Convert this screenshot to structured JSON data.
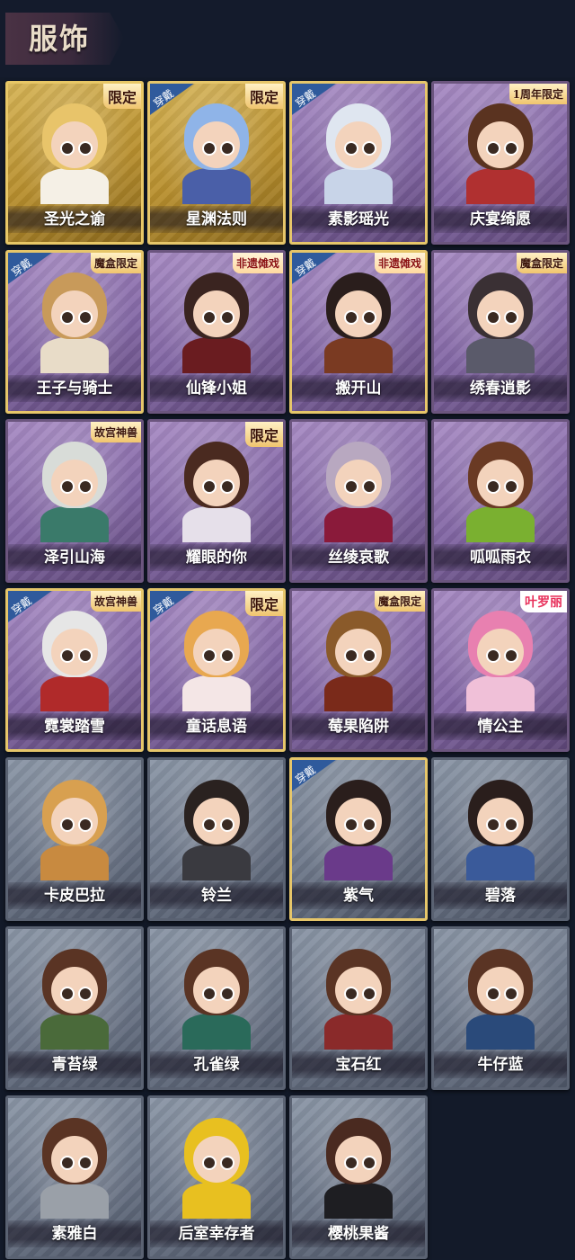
{
  "title": "服饰",
  "worn_label": "穿戴",
  "colors": {
    "gold": "#d6b456",
    "purple": "#8468a6",
    "grey": "#6d7789",
    "worn_badge": "#2f5a9c"
  },
  "costumes": [
    {
      "name": "圣光之谕",
      "rarity": "gold",
      "worn": false,
      "tag": "限定",
      "hair": "#e8c46a",
      "outfit": "#f5f0e6"
    },
    {
      "name": "星渊法则",
      "rarity": "gold",
      "worn": true,
      "tag": "限定",
      "hair": "#8fb4e8",
      "outfit": "#4a5fa8"
    },
    {
      "name": "素影瑶光",
      "rarity": "purple",
      "worn": true,
      "tag": "",
      "hair": "#dfe6f0",
      "outfit": "#c8d4e8"
    },
    {
      "name": "庆宴绮愿",
      "rarity": "purple",
      "worn": false,
      "tag": "1周年限定",
      "hair": "#5a3320",
      "outfit": "#b03030"
    },
    {
      "name": "王子与骑士",
      "rarity": "purple",
      "worn": true,
      "tag": "魔盒限定",
      "hair": "#c89a5a",
      "outfit": "#e8dcc8"
    },
    {
      "name": "仙锋小姐",
      "rarity": "purple",
      "worn": false,
      "tag": "非遗傩戏",
      "hair": "#3a2420",
      "outfit": "#6a1c20"
    },
    {
      "name": "搬开山",
      "rarity": "purple",
      "worn": true,
      "tag": "非遗傩戏",
      "hair": "#2a1e1c",
      "outfit": "#7a3a22"
    },
    {
      "name": "绣春逍影",
      "rarity": "purple",
      "worn": false,
      "tag": "魔盒限定",
      "hair": "#3a3034",
      "outfit": "#5a5a6a"
    },
    {
      "name": "泽引山海",
      "rarity": "purple",
      "worn": false,
      "tag": "故宫神兽",
      "hair": "#d8dcd8",
      "outfit": "#3a7a6a"
    },
    {
      "name": "耀眼的你",
      "rarity": "purple",
      "worn": false,
      "tag": "限定",
      "hair": "#4a2a20",
      "outfit": "#e6e0ea"
    },
    {
      "name": "丝绫哀歌",
      "rarity": "purple",
      "worn": false,
      "tag": "",
      "hair": "#b8a8c0",
      "outfit": "#8a1a3a"
    },
    {
      "name": "呱呱雨衣",
      "rarity": "purple",
      "worn": false,
      "tag": "",
      "hair": "#6a3a24",
      "outfit": "#7ab030"
    },
    {
      "name": "霓裳踏雪",
      "rarity": "purple",
      "worn": true,
      "tag": "故宫神兽",
      "hair": "#e6e6e6",
      "outfit": "#b02a2a"
    },
    {
      "name": "童话息语",
      "rarity": "purple",
      "worn": true,
      "tag": "限定",
      "hair": "#e8a850",
      "outfit": "#f4e6e6"
    },
    {
      "name": "莓果陷阱",
      "rarity": "purple",
      "worn": false,
      "tag": "魔盒限定",
      "hair": "#8a5a2a",
      "outfit": "#7a2a1a"
    },
    {
      "name": "情公主",
      "rarity": "purple",
      "worn": false,
      "tag": "叶罗丽",
      "hair": "#e880b0",
      "outfit": "#f0c0d8"
    },
    {
      "name": "卡皮巴拉",
      "rarity": "grey",
      "worn": false,
      "tag": "",
      "hair": "#d8a050",
      "outfit": "#c88a40"
    },
    {
      "name": "铃兰",
      "rarity": "grey",
      "worn": false,
      "tag": "",
      "hair": "#2a2220",
      "outfit": "#3a3a40"
    },
    {
      "name": "紫气",
      "rarity": "grey",
      "worn": true,
      "tag": "",
      "hair": "#2a1e1c",
      "outfit": "#6a3a8a"
    },
    {
      "name": "碧落",
      "rarity": "grey",
      "worn": false,
      "tag": "",
      "hair": "#2a1e1c",
      "outfit": "#3a5a9a"
    },
    {
      "name": "青苔绿",
      "rarity": "grey",
      "worn": false,
      "tag": "",
      "hair": "#5a3424",
      "outfit": "#4a6a3a"
    },
    {
      "name": "孔雀绿",
      "rarity": "grey",
      "worn": false,
      "tag": "",
      "hair": "#5a3424",
      "outfit": "#2a6a5a"
    },
    {
      "name": "宝石红",
      "rarity": "grey",
      "worn": false,
      "tag": "",
      "hair": "#5a3424",
      "outfit": "#8a2a2a"
    },
    {
      "name": "牛仔蓝",
      "rarity": "grey",
      "worn": false,
      "tag": "",
      "hair": "#5a3424",
      "outfit": "#2a4a7a"
    },
    {
      "name": "素雅白",
      "rarity": "grey",
      "worn": false,
      "tag": "",
      "hair": "#5a3424",
      "outfit": "#9aa0a8"
    },
    {
      "name": "后室幸存者",
      "rarity": "grey",
      "worn": false,
      "tag": "",
      "hair": "#e8c020",
      "outfit": "#e8c020"
    },
    {
      "name": "樱桃果酱",
      "rarity": "grey",
      "worn": false,
      "tag": "",
      "hair": "#4a2a20",
      "outfit": "#1e1e22"
    }
  ]
}
